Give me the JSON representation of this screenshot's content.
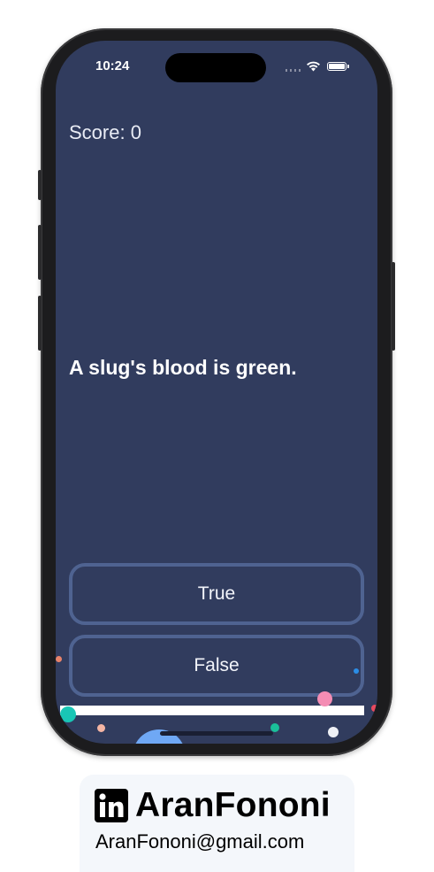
{
  "status_bar": {
    "time": "10:24"
  },
  "app": {
    "score_text": "Score: 0",
    "question": "A slug's blood is green.",
    "buttons": {
      "true_label": "True",
      "false_label": "False"
    },
    "progress_fraction": 1.0
  },
  "card": {
    "name": "AranFononi",
    "email": "AranFononi@gmail.com",
    "icon": "linkedin-icon"
  },
  "colors": {
    "background": "#313c5e",
    "button_border": "#4f6391",
    "text": "#ffffff"
  }
}
